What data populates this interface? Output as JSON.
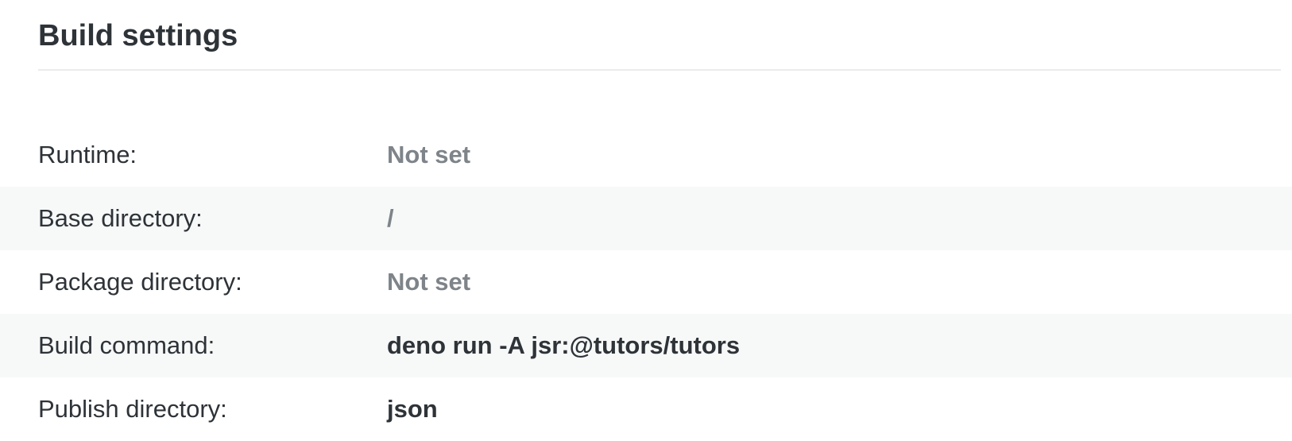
{
  "section": {
    "title": "Build settings"
  },
  "settings": [
    {
      "label": "Runtime:",
      "value": "Not set",
      "is_set": false
    },
    {
      "label": "Base directory:",
      "value": "/",
      "is_set": false
    },
    {
      "label": "Package directory:",
      "value": "Not set",
      "is_set": false
    },
    {
      "label": "Build command:",
      "value": "deno run -A jsr:@tutors/tutors",
      "is_set": true
    },
    {
      "label": "Publish directory:",
      "value": "json",
      "is_set": true
    }
  ],
  "colors": {
    "text_primary": "#2e3338",
    "text_muted": "#7e8489",
    "row_alt_background": "#f7f8f8",
    "divider": "#e9ebed"
  }
}
